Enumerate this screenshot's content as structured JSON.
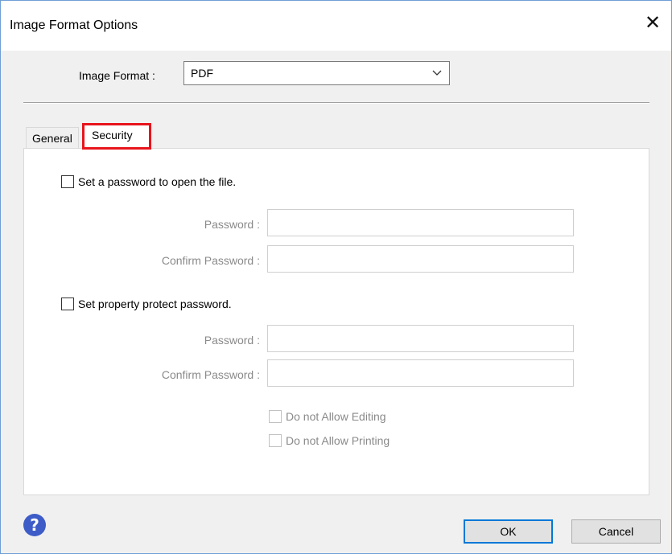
{
  "window": {
    "title": "Image Format Options"
  },
  "format": {
    "label": "Image Format :",
    "value": "PDF"
  },
  "tabs": [
    {
      "label": "General"
    },
    {
      "label": "Security"
    }
  ],
  "open_password": {
    "checkbox_label": "Set a password to open the file.",
    "password_label": "Password :",
    "confirm_label": "Confirm Password :",
    "password_value": "",
    "confirm_value": ""
  },
  "protect_password": {
    "checkbox_label": "Set property protect password.",
    "password_label": "Password :",
    "confirm_label": "Confirm Password :",
    "password_value": "",
    "confirm_value": "",
    "no_edit_label": "Do not Allow Editing",
    "no_print_label": "Do not Allow Printing"
  },
  "footer": {
    "ok_label": "OK",
    "cancel_label": "Cancel",
    "help_glyph": "?"
  },
  "colors": {
    "highlight": "#e8141c",
    "default_button_border": "#0078d7",
    "help_icon": "#3d5cc7"
  },
  "icons": {
    "close": "close-icon",
    "dropdown": "chevron-down-icon",
    "help": "help-icon"
  }
}
